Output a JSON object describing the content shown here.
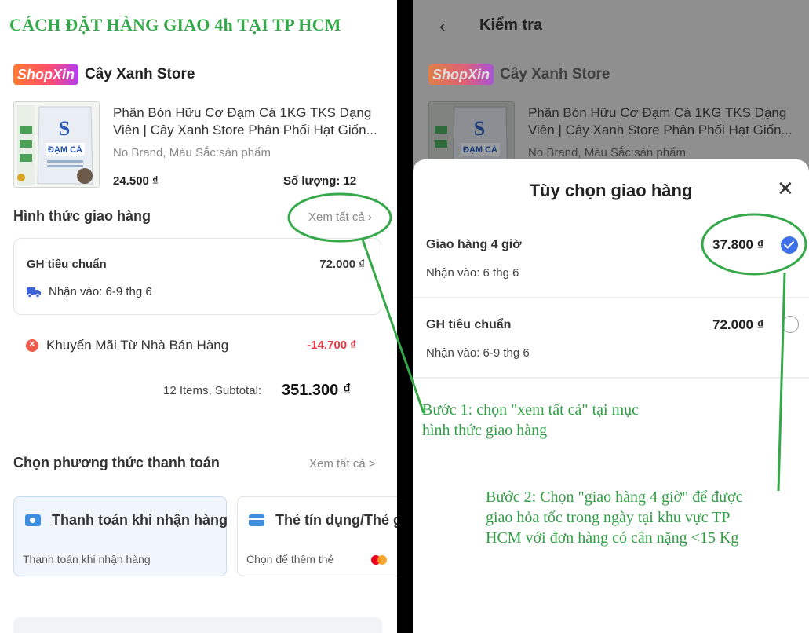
{
  "guide_title": "CÁCH ĐẶT HÀNG GIAO 4h TẠI TP HCM",
  "store": {
    "badge": "ShopXin",
    "name": "Cây Xanh Store"
  },
  "product": {
    "title": "Phân Bón Hữu Cơ Đạm Cá 1KG TKS Dạng Viên | Cây Xanh Store Phân Phối Hạt Giốn...",
    "variant": "No Brand, Màu Sắc:sản phẩm",
    "price": "24.500 ₫",
    "qty_label": "Số lượng: 12",
    "image_label": "ĐẠM CÁ"
  },
  "shipping": {
    "section_title": "Hình thức giao hàng",
    "see_all": "Xem tất cả",
    "selected_name": "GH tiêu chuẩn",
    "selected_price": "72.000 ₫",
    "selected_eta": "Nhận vào: 6-9 thg 6"
  },
  "promo": {
    "label": "Khuyến Mãi Từ Nhà Bán Hàng",
    "value": "-14.700 ₫"
  },
  "subtotal": {
    "label": "12 Items, Subtotal:",
    "value": "351.300 ₫"
  },
  "payment": {
    "section_title": "Chọn phương thức thanh toán",
    "see_all": "Xem tất cả >",
    "methods": [
      {
        "title": "Thanh toán khi nhận hàng",
        "sub": "Thanh toán khi nhận hàng"
      },
      {
        "title": "Thẻ tín dụng/Thẻ g",
        "sub": "Chọn để thêm thẻ"
      }
    ]
  },
  "checkout": {
    "header": "Kiểm tra",
    "sheet_title": "Tùy chọn giao hàng",
    "options": [
      {
        "name": "Giao hàng 4 giờ",
        "price": "37.800 ₫",
        "eta": "Nhận vào: 6 thg 6",
        "selected": true
      },
      {
        "name": "GH tiêu chuẩn",
        "price": "72.000 ₫",
        "eta": "Nhận vào: 6-9 thg 6",
        "selected": false
      }
    ]
  },
  "annotations": {
    "step1": [
      "Bước 1: chọn \"xem tất cả\" tại mục",
      "hình thức giao hàng"
    ],
    "step2": [
      "Bước 2: Chọn \"giao hàng 4 giờ\" để được",
      "giao hỏa tốc trong ngày tại khu vực TP",
      "HCM với đơn hàng có cân nặng <15 Kg"
    ]
  },
  "colors": {
    "annotation_green": "#2f9e44",
    "accent_blue": "#3d6fe6",
    "promo_red": "#e53845"
  }
}
